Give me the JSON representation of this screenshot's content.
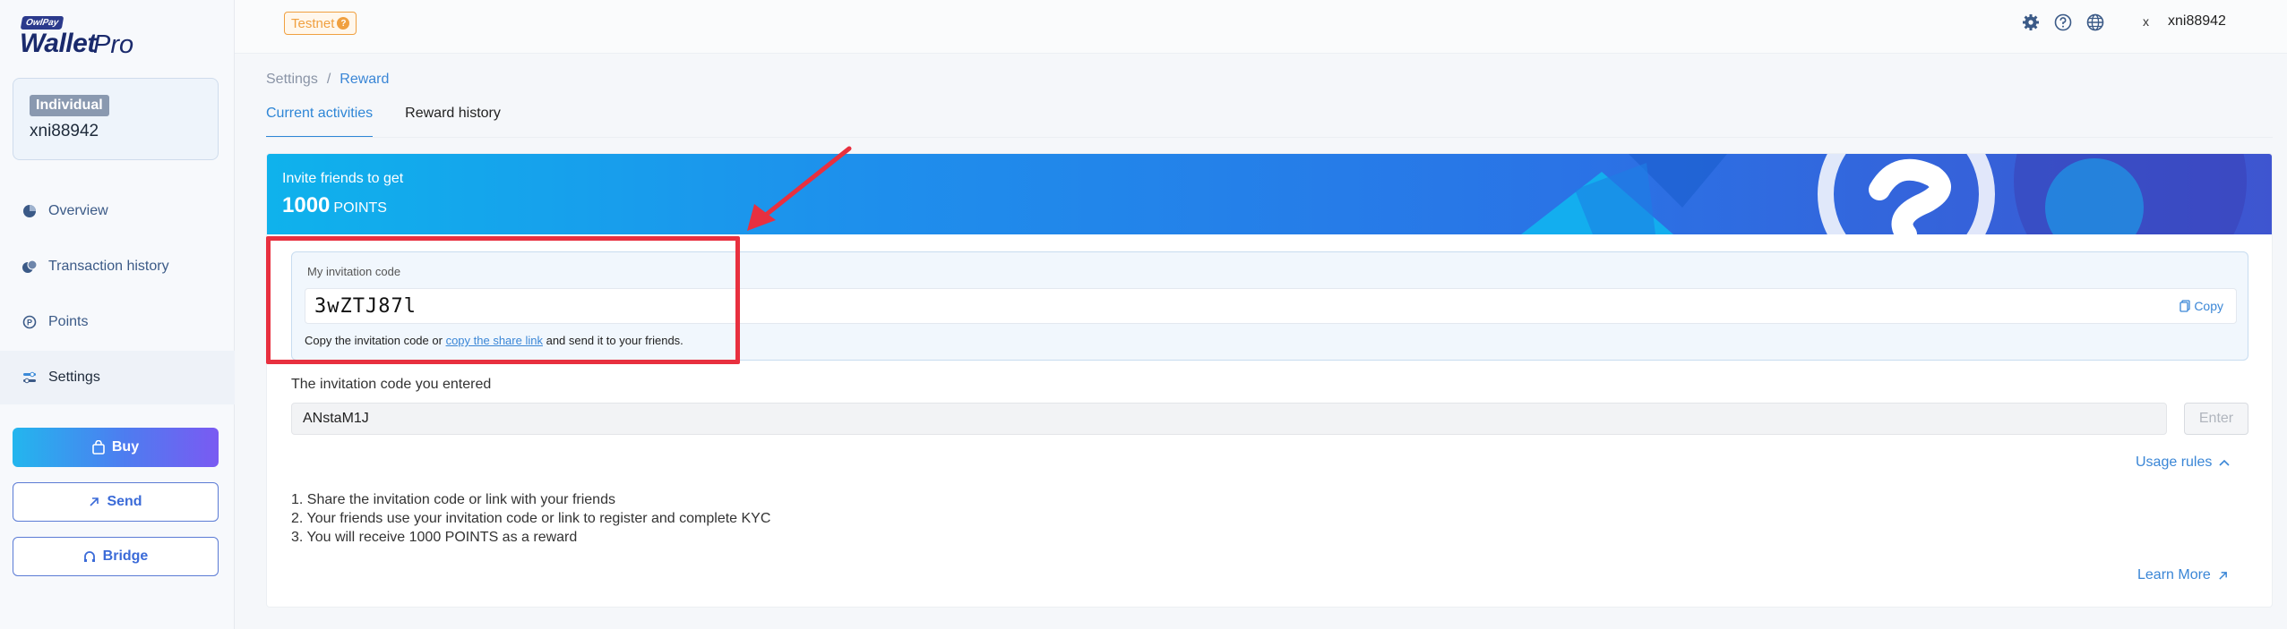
{
  "brand": {
    "logo_badge": "OwlPay",
    "logo_wallet": "Wallet",
    "logo_pro": "Pro"
  },
  "account": {
    "type_badge": "Individual",
    "username": "xni88942"
  },
  "sidebar": {
    "items": [
      {
        "label": "Overview",
        "icon": "pie-chart-icon"
      },
      {
        "label": "Transaction history",
        "icon": "coins-icon"
      },
      {
        "label": "Points",
        "icon": "points-icon"
      },
      {
        "label": "Settings",
        "icon": "sliders-icon",
        "active": true
      }
    ],
    "buy_label": "Buy",
    "send_label": "Send",
    "bridge_label": "Bridge"
  },
  "header": {
    "testnet_label": "Testnet",
    "close_mark": "x",
    "username": "xni88942"
  },
  "breadcrumb": {
    "parent": "Settings",
    "separator": "/",
    "current": "Reward"
  },
  "tabs": [
    {
      "label": "Current activities",
      "active": true
    },
    {
      "label": "Reward history",
      "active": false
    }
  ],
  "banner": {
    "line1": "Invite friends to get",
    "points_value": "1000",
    "points_unit": "POINTS"
  },
  "invitation": {
    "label": "My invitation code",
    "code": "3wZTJ87l",
    "copy_label": "Copy",
    "hint_prefix": "Copy the invitation code or",
    "hint_link": "copy the share link",
    "hint_suffix": "and send it to your friends."
  },
  "entered": {
    "label": "The invitation code you entered",
    "value": "ANstaM1J",
    "enter_label": "Enter"
  },
  "usage_rules": {
    "toggle_label": "Usage rules",
    "rules": [
      "1. Share the invitation code or link with your friends",
      "2. Your friends use your invitation code or link to register and complete KYC",
      "3. You will receive 1000 POINTS as a reward"
    ],
    "learn_more_label": "Learn More"
  },
  "colors": {
    "accent": "#3a86d6",
    "highlight": "#e8303f",
    "testnet": "#f0a040"
  }
}
